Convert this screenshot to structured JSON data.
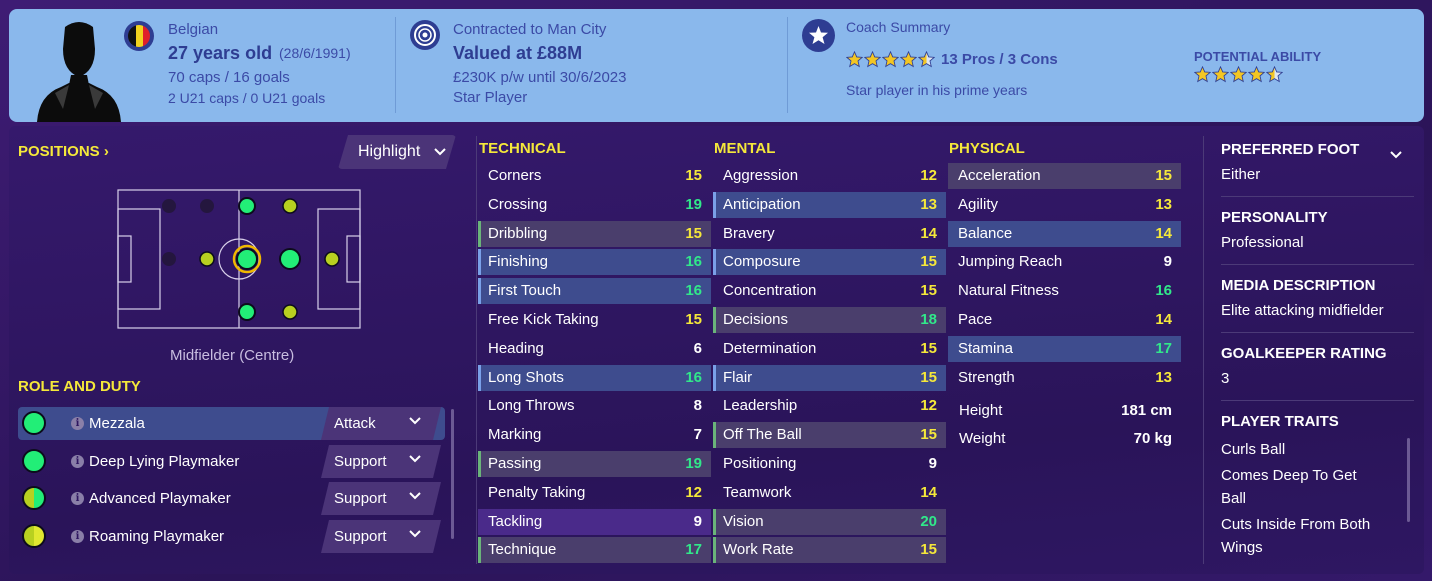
{
  "header": {
    "nationality": "Belgian",
    "age": "27 years old",
    "dob": "(28/6/1991)",
    "caps": "70 caps / 16 goals",
    "u21_caps": "2 U21 caps / 0 U21 goals",
    "contract": "Contracted to Man City",
    "value": "Valued at £88M",
    "wage": "£230K p/w until 30/6/2023",
    "status": "Star Player",
    "coach_summary_label": "Coach Summary",
    "coach_rating_stars": 4.5,
    "pros_cons": "13 Pros / 3 Cons",
    "coach_comment": "Star player in his prime years",
    "potential_label": "POTENTIAL ABILITY",
    "potential_stars": 4.5
  },
  "positions": {
    "title": "POSITIONS",
    "highlight_label": "Highlight",
    "position_label": "Midfielder (Centre)"
  },
  "roles": {
    "title": "ROLE AND DUTY",
    "items": [
      {
        "name": "Mezzala",
        "duty": "Attack"
      },
      {
        "name": "Deep Lying Playmaker",
        "duty": "Support"
      },
      {
        "name": "Advanced Playmaker",
        "duty": "Support"
      },
      {
        "name": "Roaming Playmaker",
        "duty": "Support"
      }
    ]
  },
  "technical": {
    "title": "TECHNICAL",
    "items": [
      {
        "name": "Corners",
        "value": "15"
      },
      {
        "name": "Crossing",
        "value": "19"
      },
      {
        "name": "Dribbling",
        "value": "15"
      },
      {
        "name": "Finishing",
        "value": "16"
      },
      {
        "name": "First Touch",
        "value": "16"
      },
      {
        "name": "Free Kick Taking",
        "value": "15"
      },
      {
        "name": "Heading",
        "value": "6"
      },
      {
        "name": "Long Shots",
        "value": "16"
      },
      {
        "name": "Long Throws",
        "value": "8"
      },
      {
        "name": "Marking",
        "value": "7"
      },
      {
        "name": "Passing",
        "value": "19"
      },
      {
        "name": "Penalty Taking",
        "value": "12"
      },
      {
        "name": "Tackling",
        "value": "9"
      },
      {
        "name": "Technique",
        "value": "17"
      }
    ]
  },
  "mental": {
    "title": "MENTAL",
    "items": [
      {
        "name": "Aggression",
        "value": "12"
      },
      {
        "name": "Anticipation",
        "value": "13"
      },
      {
        "name": "Bravery",
        "value": "14"
      },
      {
        "name": "Composure",
        "value": "15"
      },
      {
        "name": "Concentration",
        "value": "15"
      },
      {
        "name": "Decisions",
        "value": "18"
      },
      {
        "name": "Determination",
        "value": "15"
      },
      {
        "name": "Flair",
        "value": "15"
      },
      {
        "name": "Leadership",
        "value": "12"
      },
      {
        "name": "Off The Ball",
        "value": "15"
      },
      {
        "name": "Positioning",
        "value": "9"
      },
      {
        "name": "Teamwork",
        "value": "14"
      },
      {
        "name": "Vision",
        "value": "20"
      },
      {
        "name": "Work Rate",
        "value": "15"
      }
    ]
  },
  "physical": {
    "title": "PHYSICAL",
    "items": [
      {
        "name": "Acceleration",
        "value": "15"
      },
      {
        "name": "Agility",
        "value": "13"
      },
      {
        "name": "Balance",
        "value": "14"
      },
      {
        "name": "Jumping Reach",
        "value": "9"
      },
      {
        "name": "Natural Fitness",
        "value": "16"
      },
      {
        "name": "Pace",
        "value": "14"
      },
      {
        "name": "Stamina",
        "value": "17"
      },
      {
        "name": "Strength",
        "value": "13"
      }
    ],
    "height_label": "Height",
    "height_value": "181 cm",
    "weight_label": "Weight",
    "weight_value": "70 kg"
  },
  "info": {
    "preferred_foot_label": "PREFERRED FOOT",
    "preferred_foot": "Either",
    "personality_label": "PERSONALITY",
    "personality": "Professional",
    "media_label": "MEDIA DESCRIPTION",
    "media": "Elite attacking midfielder",
    "gk_label": "GOALKEEPER RATING",
    "gk": "3",
    "traits_label": "PLAYER TRAITS",
    "traits": [
      "Curls Ball",
      "Comes Deep To Get",
      "Ball",
      "Cuts Inside From Both",
      "Wings"
    ]
  },
  "colors": {
    "attr_white": "#ffffff",
    "attr_yellow": "#f5e83a",
    "attr_green": "#31e88a",
    "header_bg": "#8ab8ec",
    "role_green": "#22ee77",
    "role_yellowgreen": "#b8d020"
  }
}
